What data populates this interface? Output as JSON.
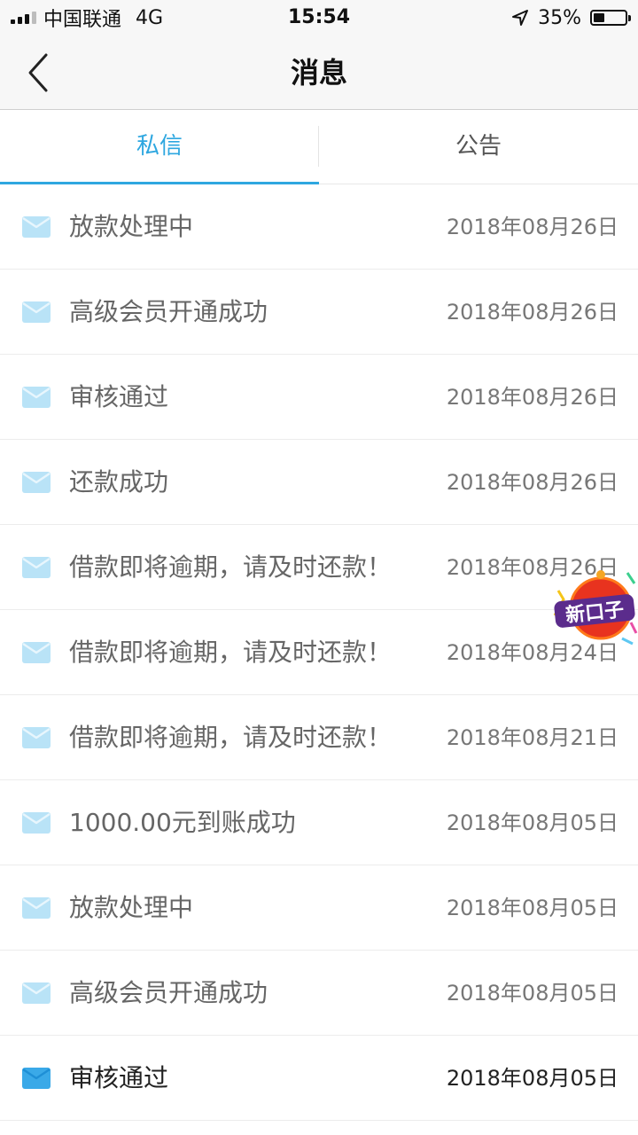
{
  "status_bar": {
    "carrier": "中国联通",
    "network": "4G",
    "time": "15:54",
    "battery_percent": "35%",
    "battery_level": 0.35,
    "icons": [
      "signal-icon",
      "location-arrow-icon",
      "battery-icon"
    ]
  },
  "header": {
    "title": "消息",
    "back_icon": "chevron-left-icon"
  },
  "tabs": [
    {
      "label": "私信",
      "active": true
    },
    {
      "label": "公告",
      "active": false
    }
  ],
  "messages": [
    {
      "title": "放款处理中",
      "date": "2018年08月26日",
      "unread": false
    },
    {
      "title": "高级会员开通成功",
      "date": "2018年08月26日",
      "unread": false
    },
    {
      "title": "审核通过",
      "date": "2018年08月26日",
      "unread": false
    },
    {
      "title": "还款成功",
      "date": "2018年08月26日",
      "unread": false
    },
    {
      "title": "借款即将逾期，请及时还款！",
      "date": "2018年08月26日",
      "unread": false
    },
    {
      "title": "借款即将逾期，请及时还款！",
      "date": "2018年08月24日",
      "unread": false
    },
    {
      "title": "借款即将逾期，请及时还款！",
      "date": "2018年08月21日",
      "unread": false
    },
    {
      "title": "1000.00元到账成功",
      "date": "2018年08月05日",
      "unread": false
    },
    {
      "title": "放款处理中",
      "date": "2018年08月05日",
      "unread": false
    },
    {
      "title": "高级会员开通成功",
      "date": "2018年08月05日",
      "unread": false
    },
    {
      "title": "审核通过",
      "date": "2018年08月05日",
      "unread": true
    }
  ],
  "float_badge": {
    "text": "新口子"
  },
  "colors": {
    "accent": "#2ea7e0",
    "envelope_read": "#b9e3f7",
    "envelope_unread": "#3aa9e8",
    "badge_red": "#e8331f",
    "badge_text_bg": "#5b2c8c"
  }
}
